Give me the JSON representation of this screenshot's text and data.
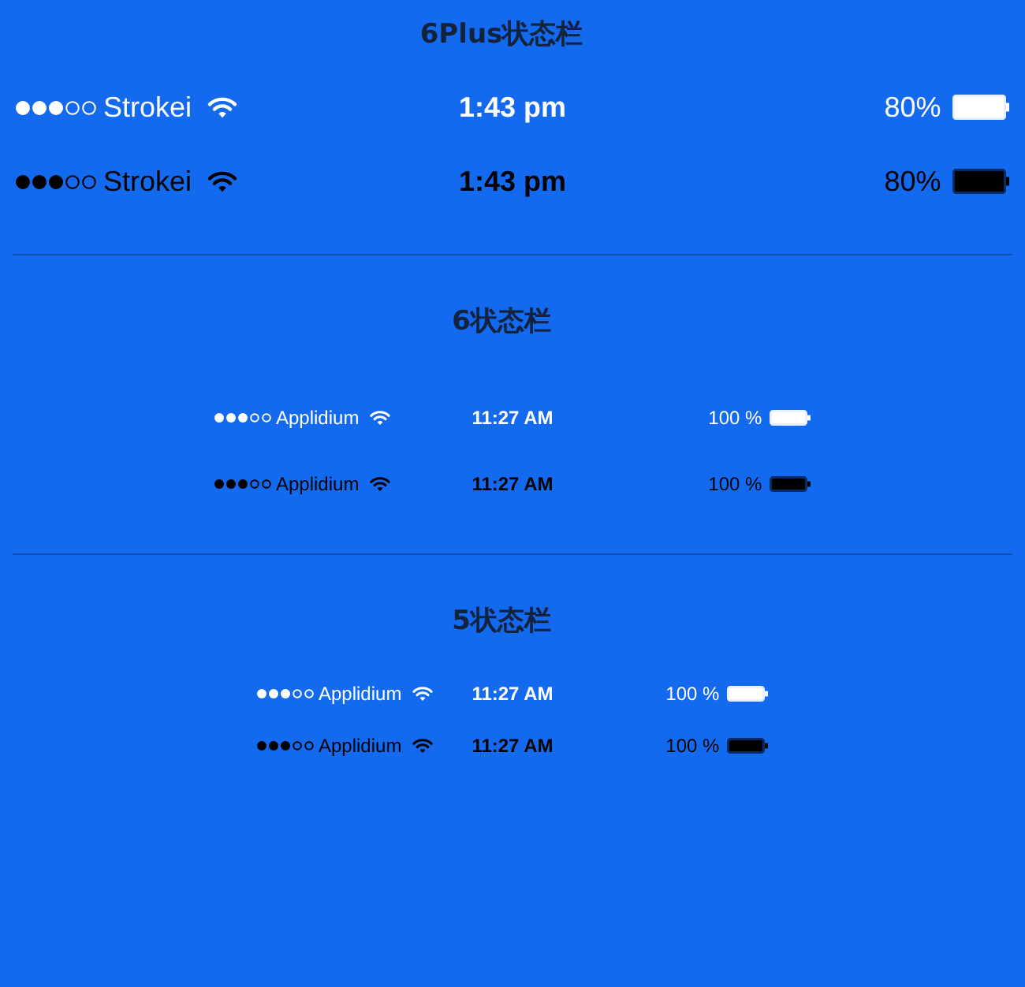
{
  "sections": [
    {
      "title": "6Plus状态栏",
      "kind": "large",
      "bars": [
        {
          "kind": "light",
          "carrier": "Strokei",
          "time": "1:43 pm",
          "battery": "80%"
        },
        {
          "kind": "dark",
          "carrier": "Strokei",
          "time": "1:43 pm",
          "battery": "80%"
        }
      ]
    },
    {
      "title": "6状态栏",
      "kind": "medium",
      "bars": [
        {
          "kind": "light",
          "carrier": "Applidium",
          "time": "11:27 AM",
          "battery": "100 %"
        },
        {
          "kind": "dark",
          "carrier": "Applidium",
          "time": "11:27 AM",
          "battery": "100 %"
        }
      ]
    },
    {
      "title": "5状态栏",
      "kind": "small",
      "bars": [
        {
          "kind": "light",
          "carrier": "Applidium",
          "time": "11:27 AM",
          "battery": "100 %"
        },
        {
          "kind": "dark",
          "carrier": "Applidium",
          "time": "11:27 AM",
          "battery": "100 %"
        }
      ]
    }
  ]
}
